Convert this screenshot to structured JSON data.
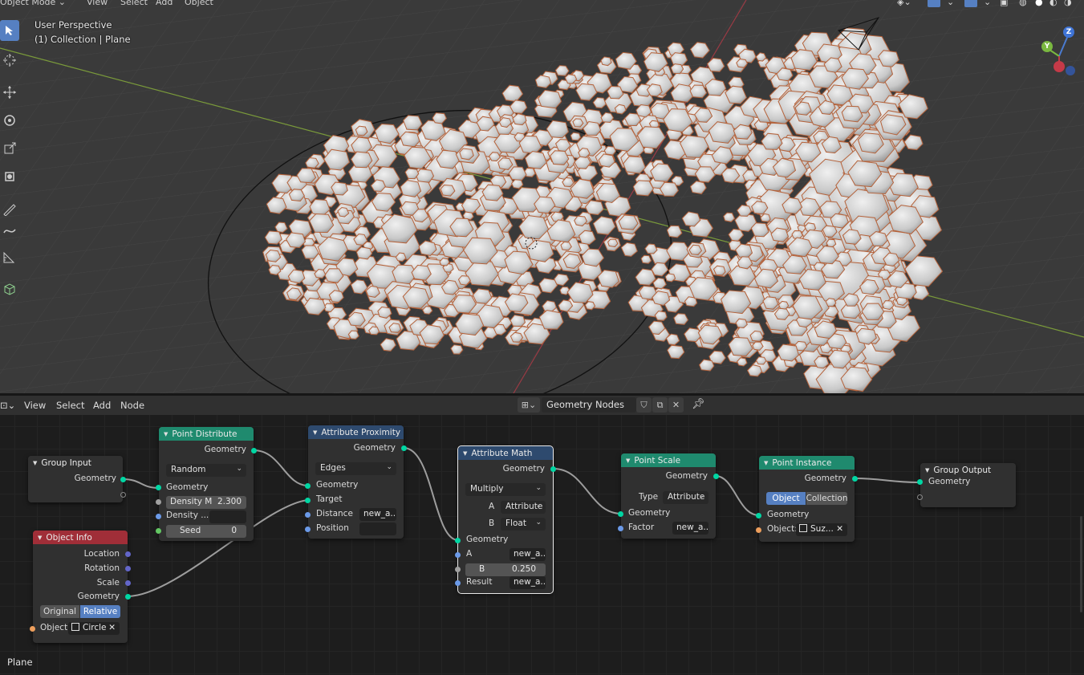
{
  "viewport": {
    "menu": [
      "Object Mode",
      "View",
      "Select",
      "Add",
      "Object"
    ],
    "info_line1": "User Perspective",
    "info_line2": "(1) Collection | Plane",
    "gizmo": {
      "x": "X",
      "y": "Y",
      "z": "Z"
    },
    "tools": [
      "select-box-icon",
      "cursor-icon",
      "move-icon",
      "rotate-icon",
      "scale-icon",
      "transform-icon",
      "annotate-icon",
      "measure-icon",
      "add-cube-icon"
    ]
  },
  "node_editor": {
    "menu": [
      "View",
      "Select",
      "Add",
      "Node"
    ],
    "node_tree_name": "Geometry Nodes",
    "colors": {
      "geometry_header": "#1f8a6e",
      "input_header": "#a02e38",
      "converter_header": "#2e4a6e",
      "socket_geometry": "#00d6a3",
      "socket_vector": "#6b9ae8",
      "socket_float": "#a1a1a1",
      "socket_int": "#63c763",
      "socket_object": "#ed9e5c",
      "accent": "#5680c2"
    },
    "nodes": {
      "group_input": {
        "title": "Group Input",
        "out_geometry": "Geometry"
      },
      "object_info": {
        "title": "Object Info",
        "location": "Location",
        "rotation": "Rotation",
        "scale": "Scale",
        "geometry": "Geometry",
        "mode_original": "Original",
        "mode_relative": "Relative",
        "object_label": "Object:",
        "object_value": "Circle"
      },
      "point_distribute": {
        "title": "Point Distribute",
        "out_geometry": "Geometry",
        "mode": "Random",
        "in_geometry": "Geometry",
        "density_max_label": "Density M",
        "density_max_value": "2.300",
        "density_attr_label": "Density ...",
        "seed_label": "Seed",
        "seed_value": "0"
      },
      "attribute_proximity": {
        "title": "Attribute Proximity",
        "out_geometry": "Geometry",
        "mode": "Edges",
        "in_geometry": "Geometry",
        "target": "Target",
        "distance_label": "Distance",
        "distance_value": "new_a...",
        "position_label": "Position"
      },
      "attribute_math": {
        "title": "Attribute Math",
        "out_geometry": "Geometry",
        "operation": "Multiply",
        "a_label": "A",
        "a_type": "Attribute",
        "b_label": "B",
        "b_type": "Float",
        "in_geometry": "Geometry",
        "a_in_label": "A",
        "a_in_value": "new_a...",
        "b_in_label": "B",
        "b_in_value": "0.250",
        "result_label": "Result",
        "result_value": "new_a..."
      },
      "point_scale": {
        "title": "Point Scale",
        "out_geometry": "Geometry",
        "type_label": "Type",
        "type_value": "Attribute",
        "in_geometry": "Geometry",
        "factor_label": "Factor",
        "factor_value": "new_a..."
      },
      "point_instance": {
        "title": "Point Instance",
        "out_geometry": "Geometry",
        "mode_object": "Object",
        "mode_collection": "Collection",
        "in_geometry": "Geometry",
        "object_label": "Object:",
        "object_value": "Suz..."
      },
      "group_output": {
        "title": "Group Output",
        "in_geometry": "Geometry"
      }
    }
  },
  "footer": {
    "active_object": "Plane"
  }
}
